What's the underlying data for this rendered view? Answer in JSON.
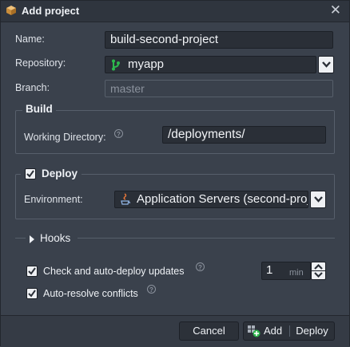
{
  "dialog": {
    "title": "Add project",
    "icons": {
      "title": "box-icon",
      "close": "close-icon"
    }
  },
  "form": {
    "name_label": "Name:",
    "name_value": "build-second-project",
    "repository_label": "Repository:",
    "repository_value": "myapp",
    "branch_label": "Branch:",
    "branch_placeholder": "master"
  },
  "build": {
    "legend": "Build",
    "working_dir_label": "Working Directory:",
    "working_dir_value": "/deployments/"
  },
  "deploy": {
    "legend": "Deploy",
    "checked": true,
    "environment_label": "Environment:",
    "environment_value": "Application Servers (second-project)"
  },
  "hooks": {
    "label": "Hooks",
    "expanded": false
  },
  "options": {
    "auto_deploy_label": "Check and auto-deploy updates",
    "auto_deploy_checked": true,
    "interval_value": "1",
    "interval_unit": "min",
    "auto_resolve_label": "Auto-resolve conflicts",
    "auto_resolve_checked": true
  },
  "footer": {
    "cancel_label": "Cancel",
    "add_label": "Add",
    "deploy_label": "Deploy"
  },
  "colors": {
    "background": "#3a414c",
    "field_background": "#2a2f37",
    "border": "#575f6b",
    "git_green": "#2db84d"
  }
}
